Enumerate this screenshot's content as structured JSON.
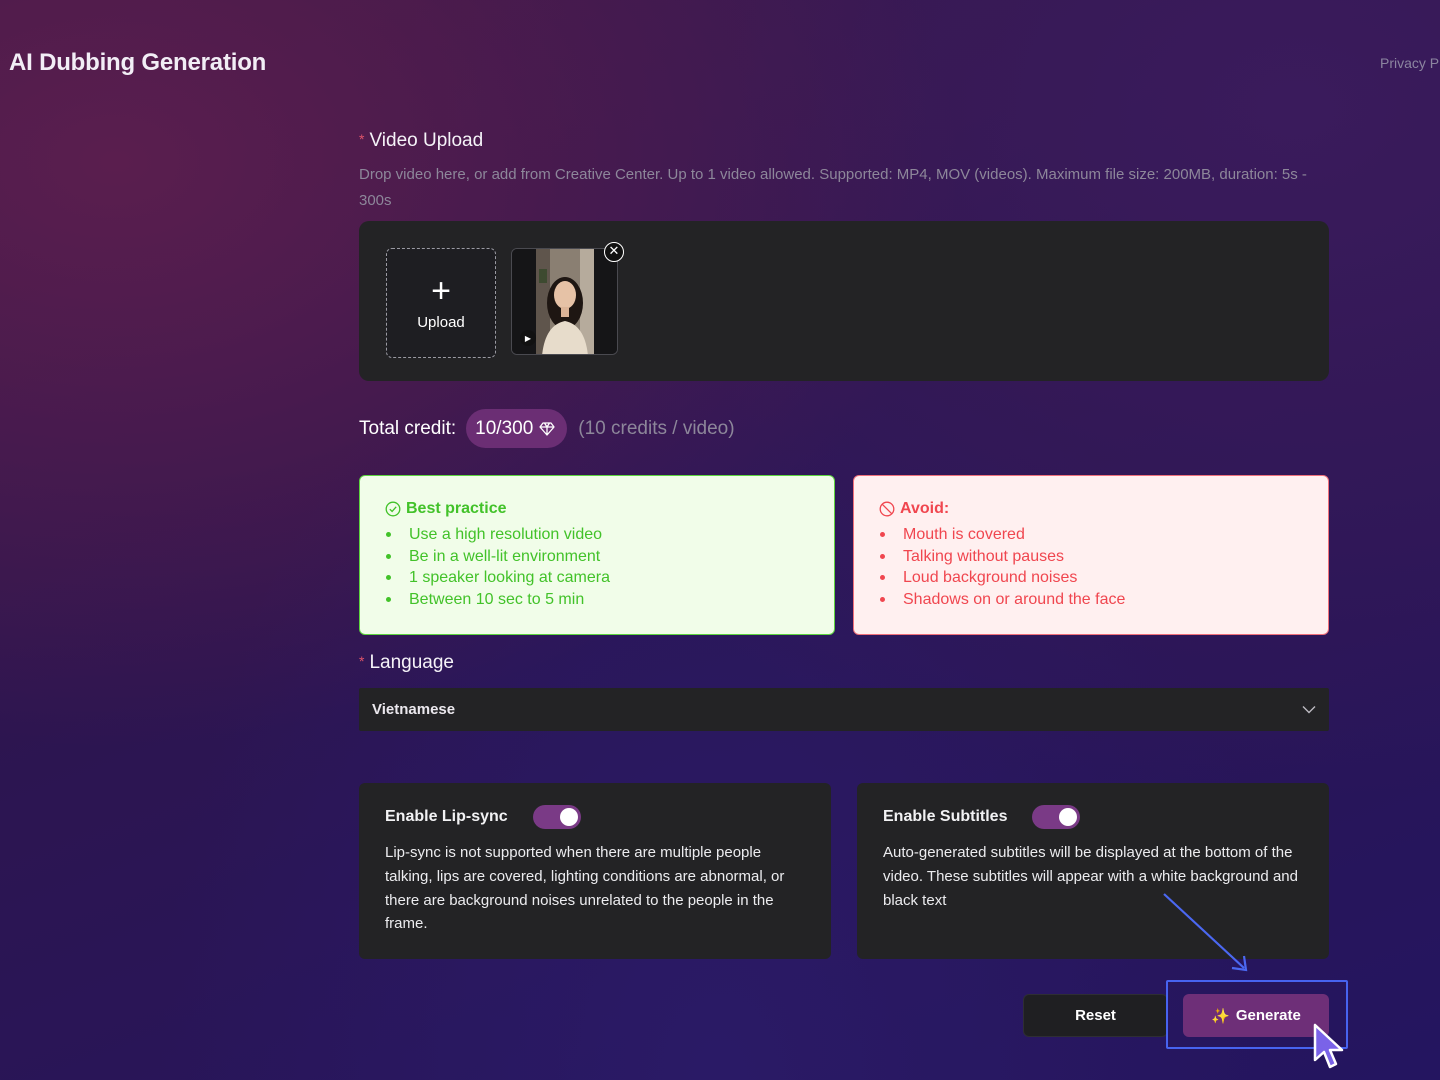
{
  "header": {
    "title": "AI Dubbing Generation",
    "privacy_link": "Privacy P"
  },
  "upload": {
    "label": "Video Upload",
    "hint": "Drop video here, or add from Creative Center. Up to 1 video allowed. Supported: MP4, MOV (videos). Maximum file size: 200MB, duration: 5s - 300s",
    "button_label": "Upload",
    "icons": {
      "add": "plus-icon",
      "remove": "close-icon",
      "play": "play-icon"
    }
  },
  "credit": {
    "label": "Total credit:",
    "value": "10/300",
    "icon": "diamond-icon",
    "note": "(10 credits / video)"
  },
  "best_practice": {
    "title": "Best practice",
    "icon": "check-circle-icon",
    "items": [
      "Use a high resolution video",
      "Be in a well-lit environment",
      "1 speaker looking at camera",
      "Between 10 sec to 5 min"
    ]
  },
  "avoid": {
    "title": "Avoid:",
    "icon": "ban-icon",
    "items": [
      "Mouth is covered",
      "Talking without pauses",
      "Loud background noises",
      "Shadows on or around the face"
    ]
  },
  "language": {
    "label": "Language",
    "selected": "Vietnamese",
    "icon": "chevron-down-icon"
  },
  "options": {
    "lip_sync": {
      "title": "Enable Lip-sync",
      "enabled": true,
      "description": "Lip-sync is not supported when there are multiple people talking, lips are covered, lighting conditions are abnormal, or there are background noises unrelated to the people in the frame."
    },
    "subtitles": {
      "title": "Enable Subtitles",
      "enabled": true,
      "description": "Auto-generated subtitles will be displayed at the bottom of the video. These subtitles will appear with a white background and black text"
    }
  },
  "actions": {
    "reset_label": "Reset",
    "generate_label": "Generate",
    "generate_icon": "sparkle-icon"
  },
  "colors": {
    "accent": "#6e2f78",
    "success": "#42c229",
    "danger": "#f0464f",
    "highlight": "#4763f0"
  }
}
